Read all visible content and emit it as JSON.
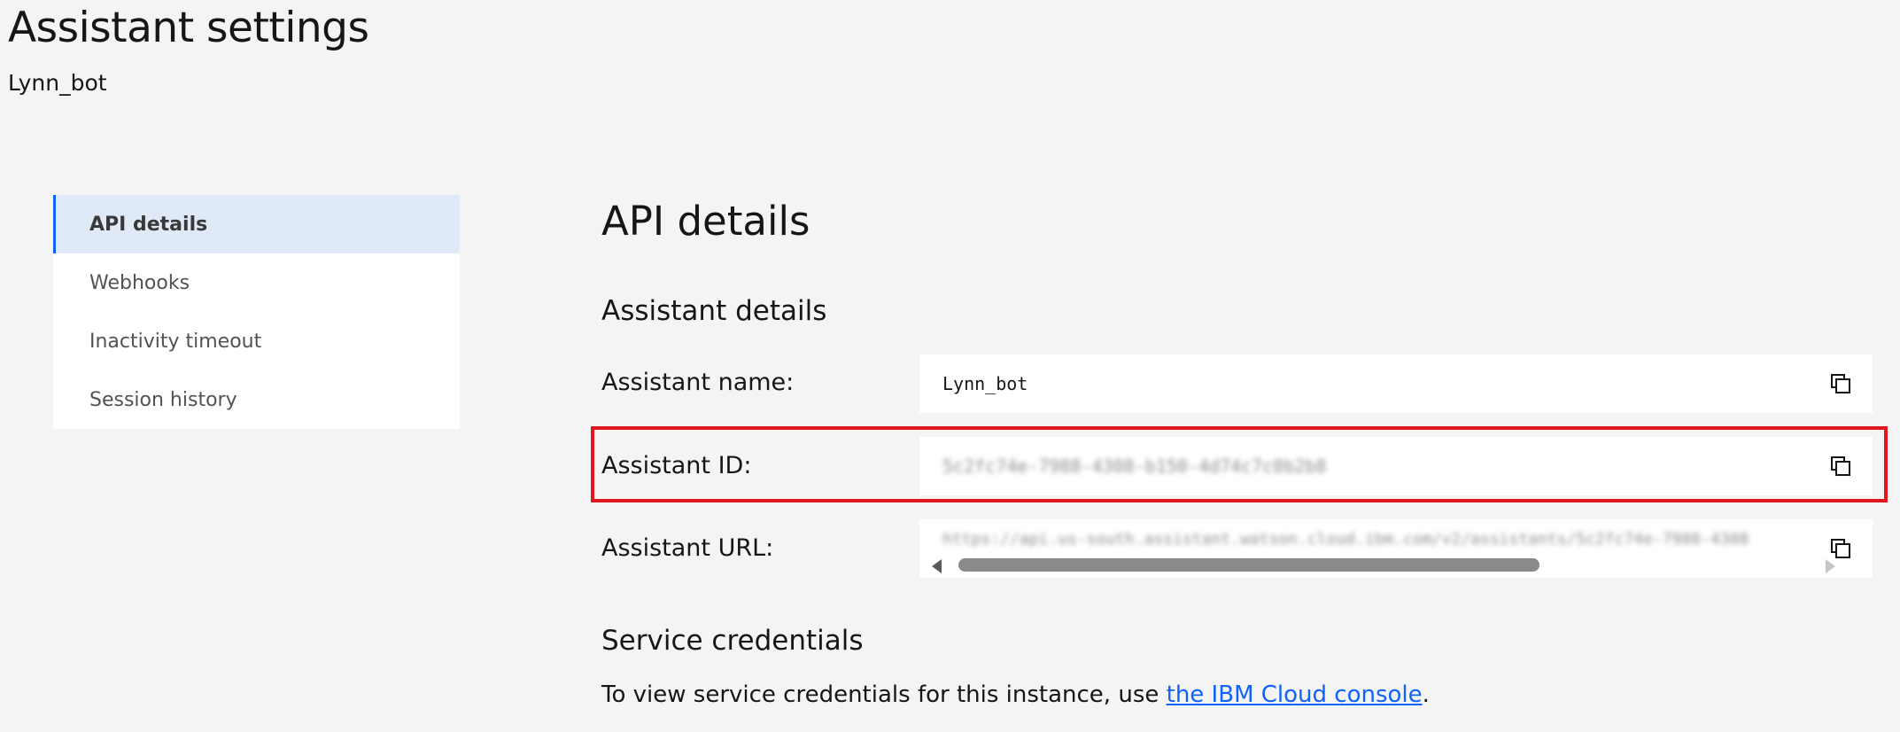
{
  "header": {
    "title": "Assistant settings",
    "assistant_name": "Lynn_bot"
  },
  "sidebar": {
    "items": [
      {
        "label": "API details",
        "active": true
      },
      {
        "label": "Webhooks",
        "active": false
      },
      {
        "label": "Inactivity timeout",
        "active": false
      },
      {
        "label": "Session history",
        "active": false
      }
    ]
  },
  "main": {
    "title": "API details",
    "assistant_section": {
      "title": "Assistant details",
      "fields": [
        {
          "label": "Assistant name:",
          "value": "Lynn_bot",
          "blurred": false
        },
        {
          "label": "Assistant ID:",
          "value": "5c2fc74e-7988-4308-b150-4d74c7c0b2b8",
          "blurred": true
        },
        {
          "label": "Assistant URL:",
          "value": "https://api.us-south.assistant.watson.cloud.ibm.com/v2/assistants/5c2fc74e-7988-4308",
          "blurred": true
        }
      ]
    },
    "credentials_section": {
      "title": "Service credentials",
      "text_before": "To view service credentials for this instance, use ",
      "link_text": "the IBM Cloud console",
      "text_after": "."
    }
  },
  "icons": {
    "copy": "copy-icon",
    "scroll_left": "scroll-left-arrow-icon",
    "scroll_right": "scroll-right-arrow-icon"
  },
  "colors": {
    "background": "#f4f4f4",
    "active_item_bg": "#e0eaf7",
    "active_item_border": "#0f62fe",
    "link": "#0f62fe",
    "highlight": "#e0161e"
  }
}
